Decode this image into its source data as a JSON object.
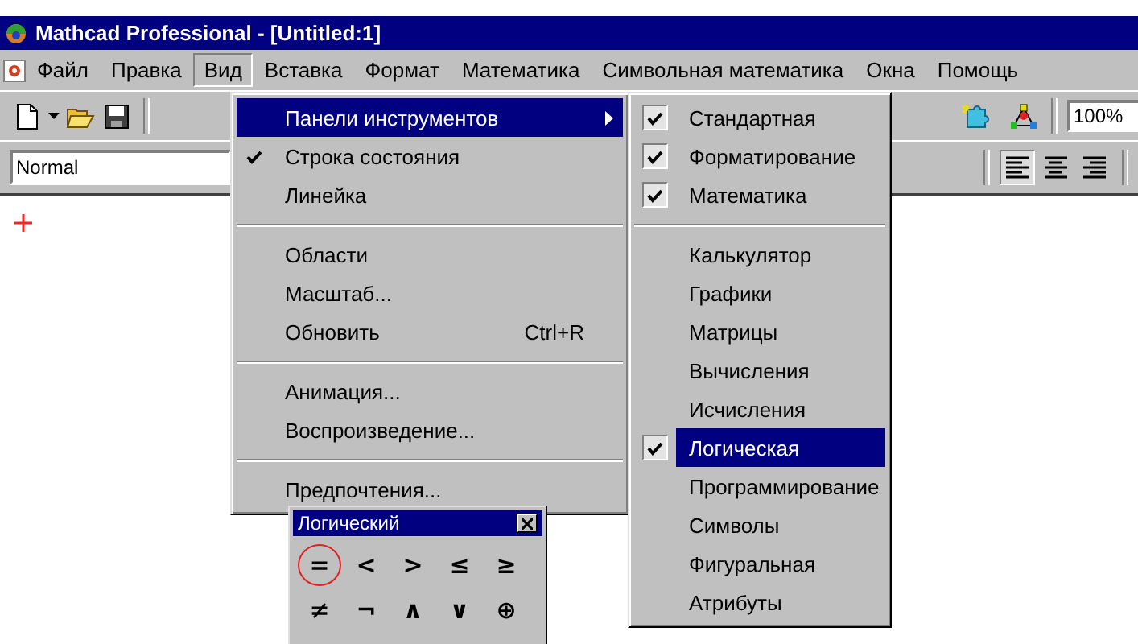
{
  "window": {
    "title": "Mathcad Professional - [Untitled:1]"
  },
  "menu_bar": [
    {
      "label": "Файл",
      "selected": false
    },
    {
      "label": "Правка",
      "selected": false
    },
    {
      "label": "Вид",
      "selected": true
    },
    {
      "label": "Вставка",
      "selected": false
    },
    {
      "label": "Формат",
      "selected": false
    },
    {
      "label": "Математика",
      "selected": false
    },
    {
      "label": "Символьная математика",
      "selected": false
    },
    {
      "label": "Окна",
      "selected": false
    },
    {
      "label": "Помощь",
      "selected": false
    }
  ],
  "toolbar": {
    "zoom": {
      "value": "100%"
    }
  },
  "format_bar": {
    "style": {
      "value": "Normal"
    },
    "align_buttons": [
      {
        "selected": true
      },
      {
        "selected": false
      },
      {
        "selected": false
      }
    ]
  },
  "view_menu": [
    {
      "kind": "item",
      "label": "Панели инструментов",
      "selected": true,
      "checked": false,
      "submenu": true
    },
    {
      "kind": "item",
      "label": "Строка состояния",
      "selected": false,
      "checked": true,
      "submenu": false
    },
    {
      "kind": "item",
      "label": "Линейка",
      "selected": false,
      "checked": false,
      "submenu": false
    },
    {
      "kind": "separator"
    },
    {
      "kind": "item",
      "label": "Области",
      "selected": false,
      "checked": false,
      "submenu": false
    },
    {
      "kind": "item",
      "label": "Масштаб...",
      "selected": false,
      "checked": false,
      "submenu": false
    },
    {
      "kind": "item",
      "label": "Обновить",
      "shortcut": "Ctrl+R",
      "selected": false,
      "checked": false,
      "submenu": false
    },
    {
      "kind": "separator"
    },
    {
      "kind": "item",
      "label": "Анимация...",
      "selected": false,
      "checked": false,
      "submenu": false
    },
    {
      "kind": "item",
      "label": "Воспроизведение...",
      "selected": false,
      "checked": false,
      "submenu": false
    },
    {
      "kind": "separator"
    },
    {
      "kind": "item",
      "label": "Предпочтения...",
      "selected": false,
      "checked": false,
      "submenu": false
    }
  ],
  "toolbars_submenu": [
    {
      "kind": "item",
      "label": "Стандартная",
      "selected": false,
      "checked": true
    },
    {
      "kind": "item",
      "label": "Форматирование",
      "selected": false,
      "checked": true
    },
    {
      "kind": "item",
      "label": "Математика",
      "selected": false,
      "checked": true
    },
    {
      "kind": "separator"
    },
    {
      "kind": "item",
      "label": "Калькулятор",
      "selected": false,
      "checked": false
    },
    {
      "kind": "item",
      "label": "Графики",
      "selected": false,
      "checked": false
    },
    {
      "kind": "item",
      "label": "Матрицы",
      "selected": false,
      "checked": false
    },
    {
      "kind": "item",
      "label": "Вычисления",
      "selected": false,
      "checked": false
    },
    {
      "kind": "item",
      "label": "Исчисления",
      "selected": false,
      "checked": false
    },
    {
      "kind": "item",
      "label": "Логическая",
      "selected": true,
      "checked": true
    },
    {
      "kind": "item",
      "label": "Программирование",
      "selected": false,
      "checked": false
    },
    {
      "kind": "item",
      "label": "Символы",
      "selected": false,
      "checked": false
    },
    {
      "kind": "item",
      "label": "Фигуральная",
      "selected": false,
      "checked": false
    },
    {
      "kind": "item",
      "label": "Атрибуты",
      "selected": false,
      "checked": false
    }
  ],
  "palette": {
    "title": "Логический",
    "buttons": [
      {
        "symbol": "=",
        "selected": true
      },
      {
        "symbol": "<",
        "selected": false
      },
      {
        "symbol": ">",
        "selected": false
      },
      {
        "symbol": "≤",
        "selected": false
      },
      {
        "symbol": "≥",
        "selected": false
      },
      {
        "symbol": "≠",
        "selected": false
      },
      {
        "symbol": "¬",
        "selected": false
      },
      {
        "symbol": "∧",
        "selected": false
      },
      {
        "symbol": "∨",
        "selected": false
      },
      {
        "symbol": "⊕",
        "selected": false
      }
    ]
  }
}
